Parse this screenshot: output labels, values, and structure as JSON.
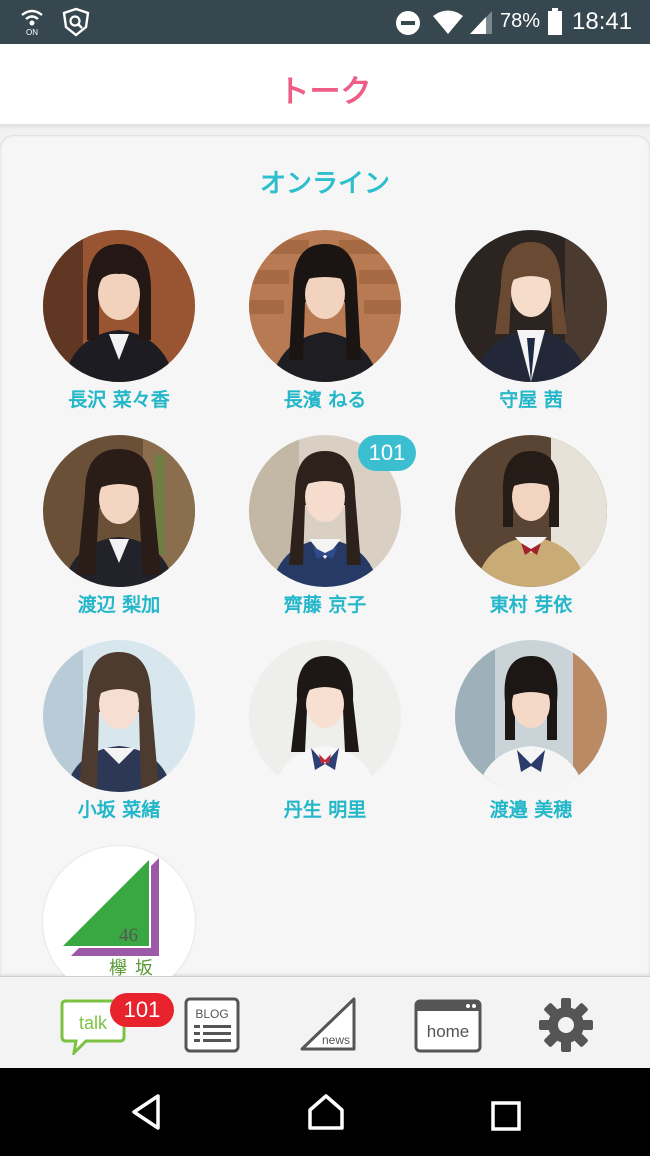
{
  "status_bar": {
    "battery": "78%",
    "time": "18:41",
    "icons": [
      "wifi-calling-on-icon",
      "shield-app-icon",
      "do-not-disturb-icon",
      "wifi-icon",
      "cellular-signal-icon",
      "battery-icon"
    ]
  },
  "header": {
    "title": "トーク"
  },
  "section": {
    "title": "オンライン"
  },
  "members": [
    {
      "name": "長沢 菜々香",
      "badge": ""
    },
    {
      "name": "長濱 ねる",
      "badge": ""
    },
    {
      "name": "守屋 茜",
      "badge": ""
    },
    {
      "name": "渡辺 梨加",
      "badge": ""
    },
    {
      "name": "齊藤 京子",
      "badge": "101"
    },
    {
      "name": "東村 芽依",
      "badge": ""
    },
    {
      "name": "小坂 菜緒",
      "badge": ""
    },
    {
      "name": "丹生 明里",
      "badge": ""
    },
    {
      "name": "渡邉 美穂",
      "badge": ""
    }
  ],
  "group_logo": {
    "number": "46",
    "name": "欅坂"
  },
  "tabs": [
    {
      "icon": "talk-icon",
      "label": "talk",
      "badge": "101"
    },
    {
      "icon": "blog-icon",
      "label": "BLOG"
    },
    {
      "icon": "news-icon",
      "label": "news"
    },
    {
      "icon": "home-icon",
      "label": "home"
    },
    {
      "icon": "gear-icon",
      "label": ""
    }
  ],
  "colors": {
    "title_pink": "#ee5d86",
    "accent_teal": "#2ebfcf",
    "name_teal": "#24b7c9",
    "badge_teal": "#3bbfd0",
    "badge_red": "#e8232d",
    "status_bar": "#37474f",
    "talk_green": "#7cc242",
    "logo_green": "#3aa842",
    "logo_purple": "#9b59a8"
  }
}
